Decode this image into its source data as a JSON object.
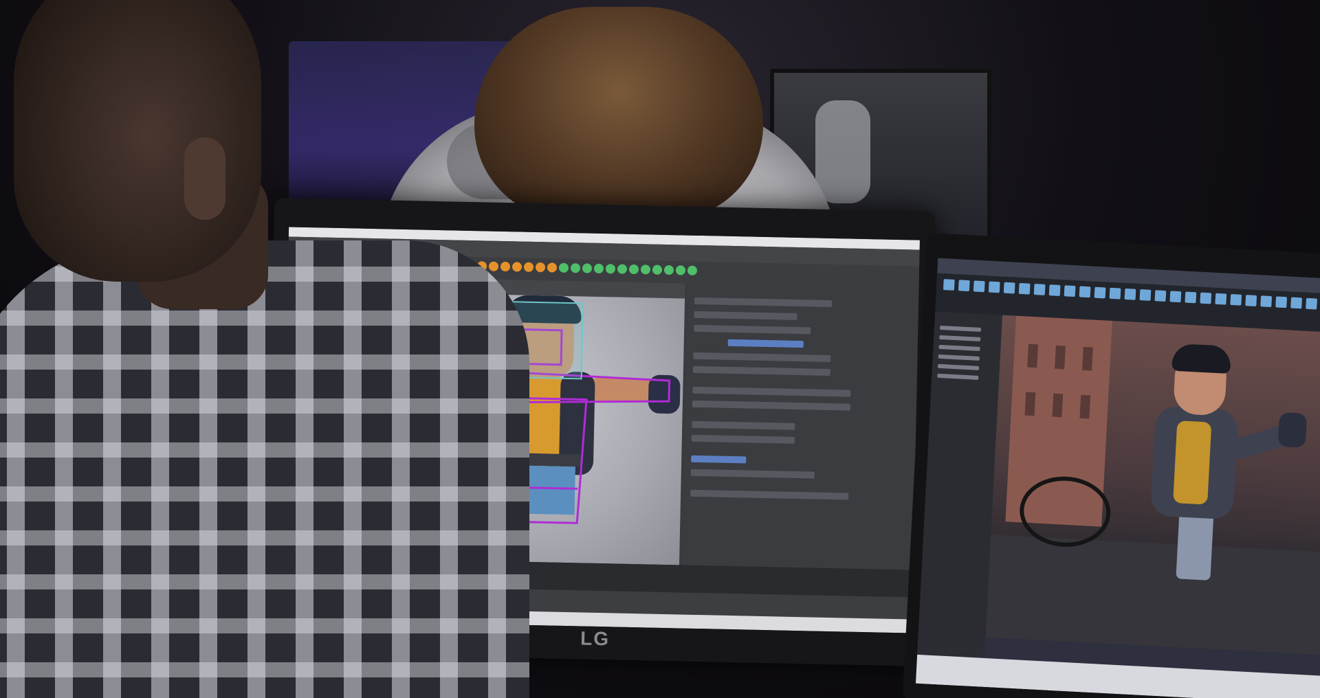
{
  "scene": {
    "description_label": "",
    "main_monitor": {
      "brand_logo": "LG"
    }
  },
  "colors": {
    "viewport_bg": "#b3b4bb",
    "rig_controls": "#b02bd6",
    "accent_selection": "#5c7fc4",
    "shelf_orange": "#e6922a",
    "shelf_green": "#4fbf6a"
  }
}
